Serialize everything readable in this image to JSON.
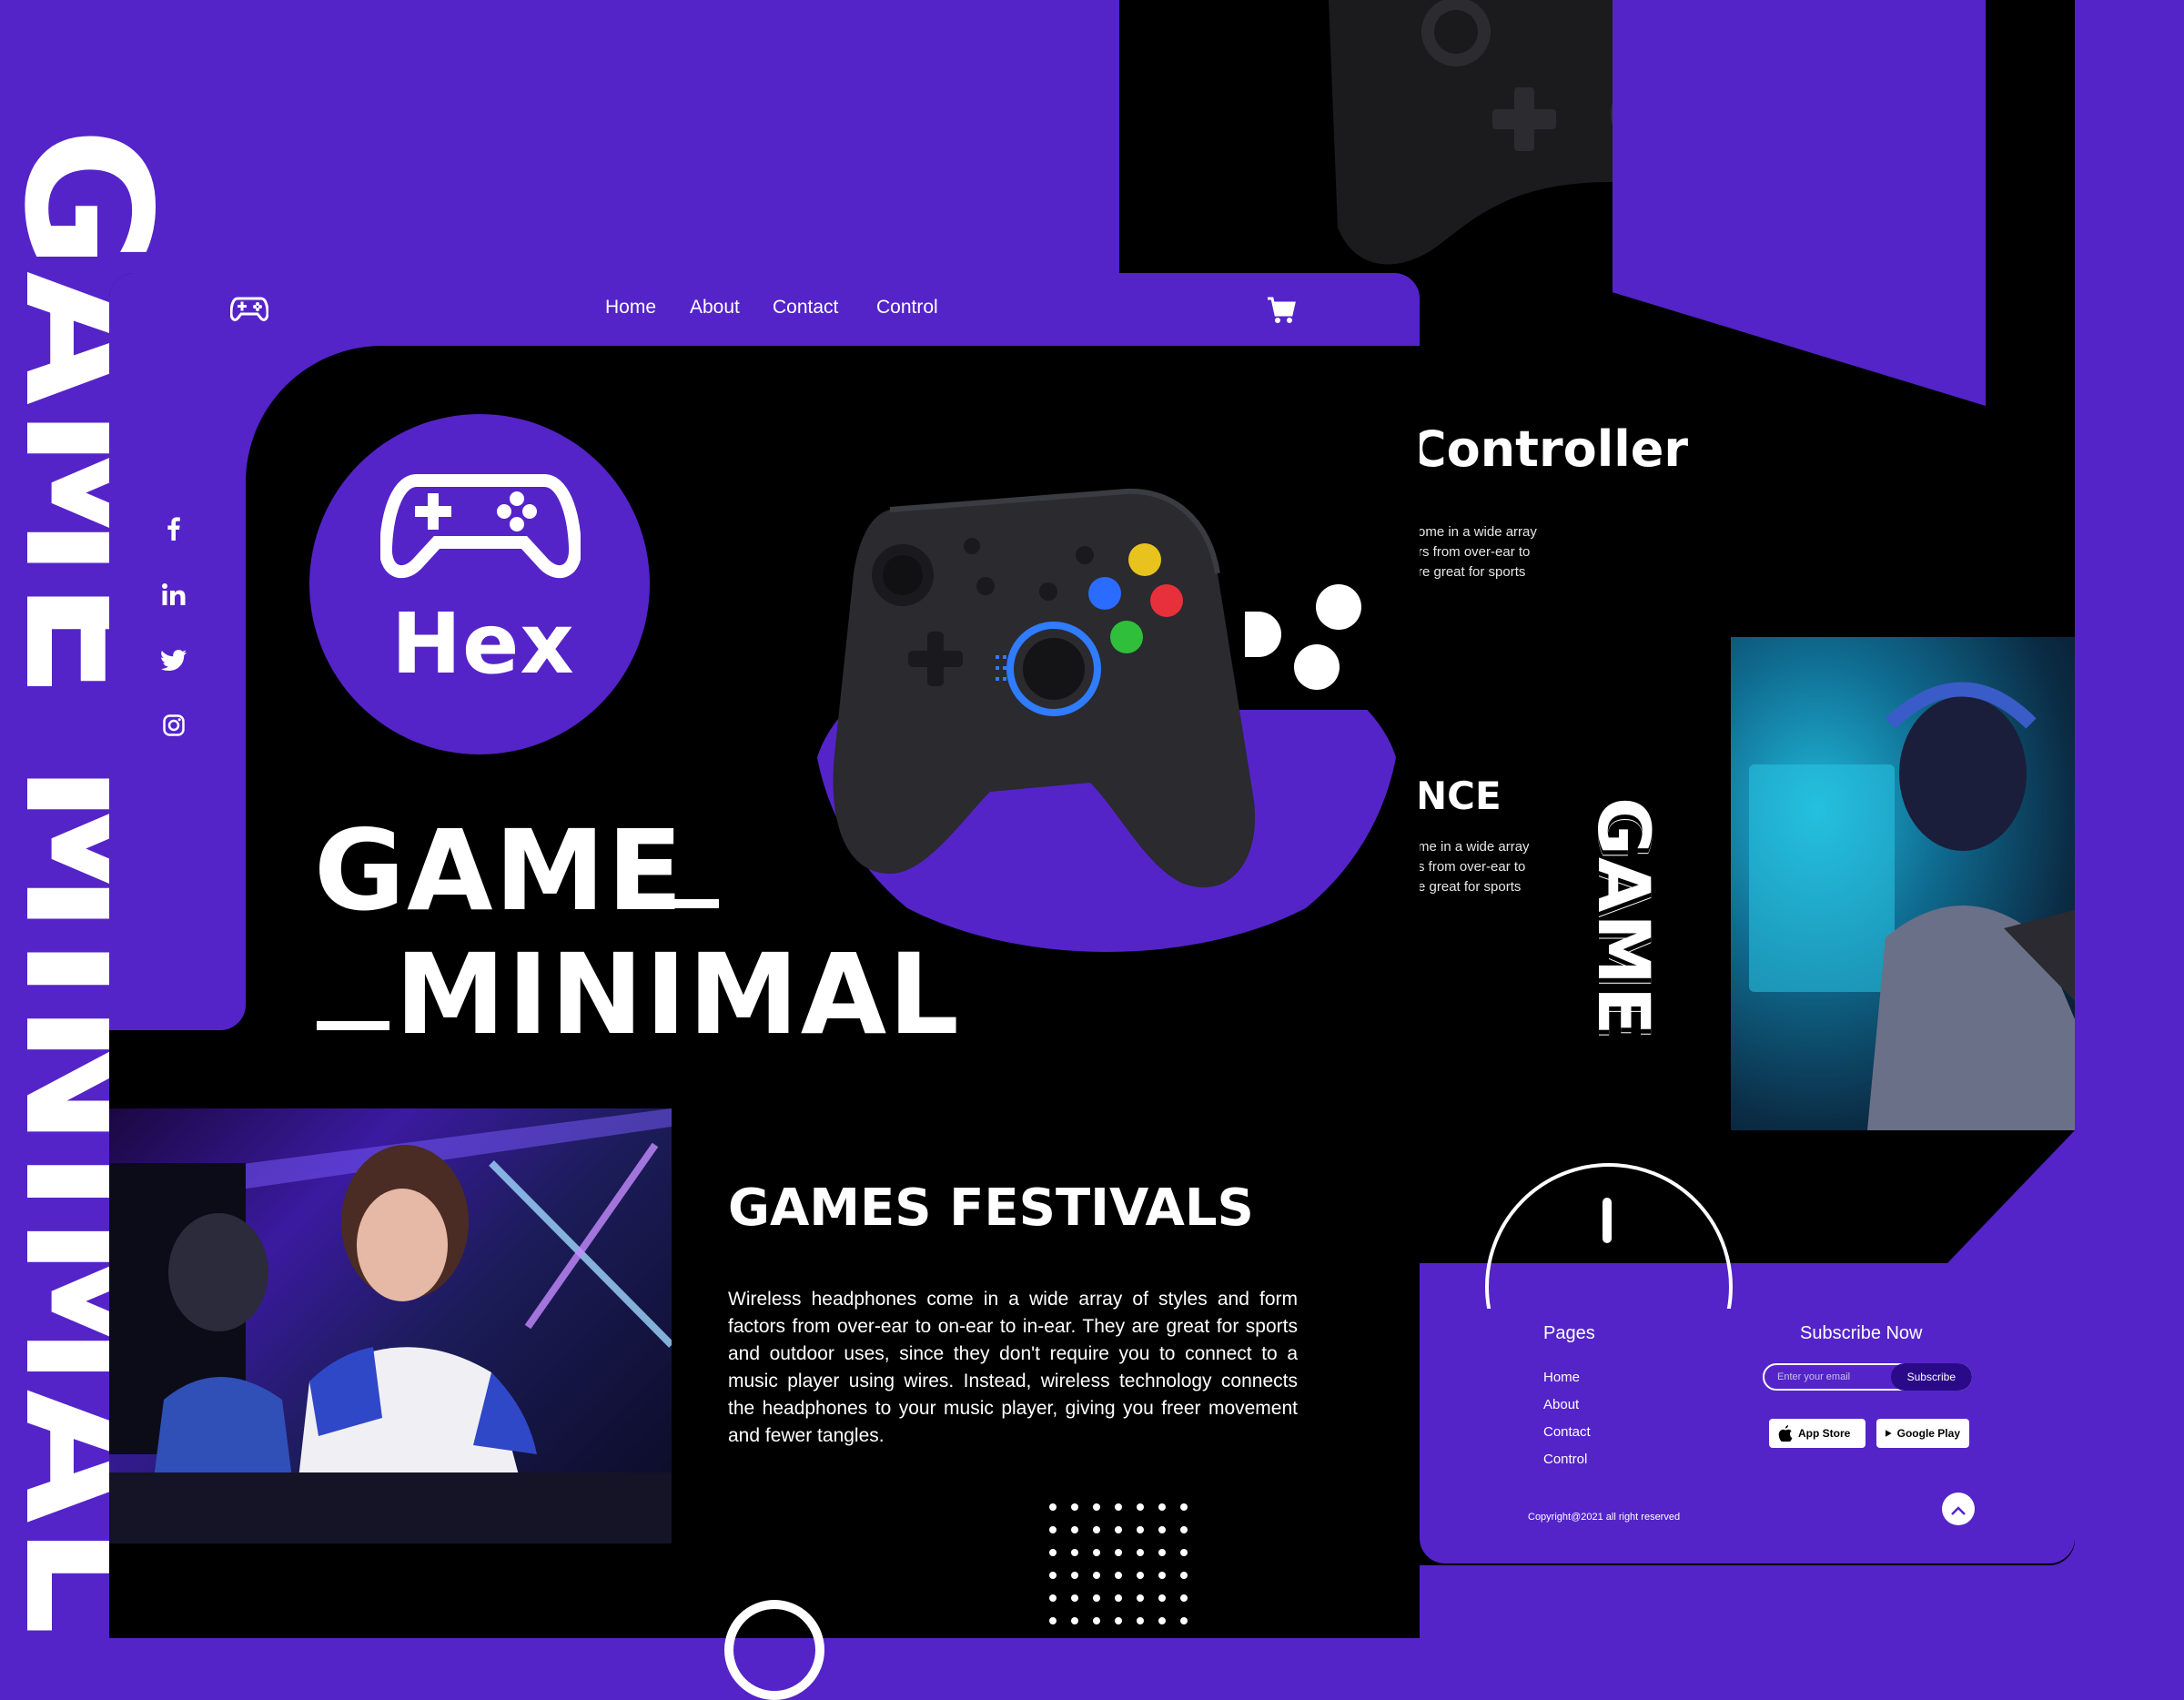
{
  "background_title": "GAME MINIMAL",
  "nav": {
    "links": [
      "Home",
      "About",
      "Contact",
      "Control"
    ]
  },
  "logo": {
    "text": "Hex"
  },
  "hero": {
    "line1": "GAME",
    "line2": "MINIMAL"
  },
  "social": [
    "facebook-icon",
    "linkedin-icon",
    "twitter-icon",
    "instagram-icon"
  ],
  "festival": {
    "title": "GAMES FESTIVALS",
    "body": "Wireless headphones come in a wide array of styles and form factors from over-ear to on-ear to in-ear. They are great for sports and outdoor uses, since they don't require you to connect to a music player using wires. Instead, wireless technology connects the headphones to your music player, giving you freer movement and fewer tangles."
  },
  "back": {
    "heading": "Controller",
    "text1": "ome in a wide array\nrs from over-ear to\nre great for sports",
    "subheading": "NCE",
    "text2": "me in a wide array\ns from over-ear to\ne great for sports",
    "vertical": "GAME"
  },
  "footer": {
    "pages_title": "Pages",
    "pages": [
      "Home",
      "About",
      "Contact",
      "Control"
    ],
    "subscribe_title": "Subscribe Now",
    "email_placeholder": "Enter your email",
    "subscribe_button": "Subscribe",
    "app_store": "App Store",
    "google_play": "Google Play",
    "copyright": "Copyright@2021 all right reserved"
  },
  "colors": {
    "accent": "#5424c9",
    "page": "#000000",
    "text": "#ffffff"
  }
}
